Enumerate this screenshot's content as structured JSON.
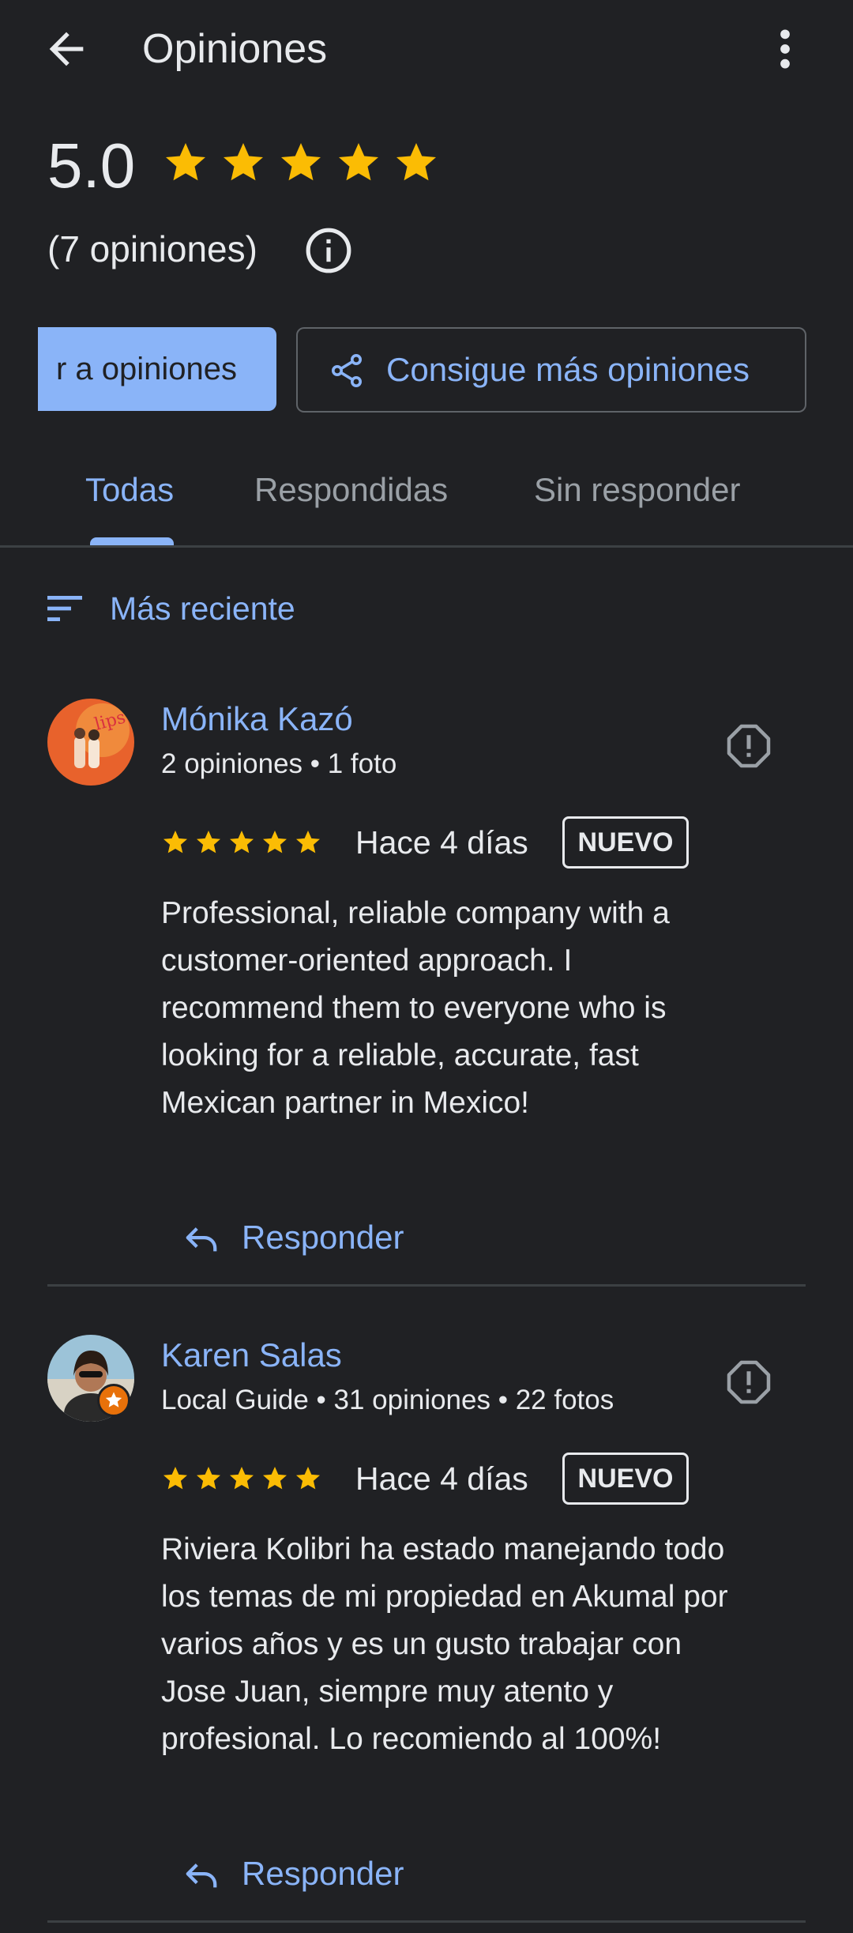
{
  "header": {
    "title": "Opiniones",
    "back_icon": "arrow-left-icon",
    "more_icon": "more-vert-icon"
  },
  "summary": {
    "rating": "5.0",
    "stars": 5,
    "count_text": "(7 opiniones)",
    "star_color": "#fbbc04"
  },
  "actions": {
    "primary_label": "Responder a opiniones",
    "primary_visible": "r a opiniones",
    "secondary_label": "Consigue más opiniones"
  },
  "tabs": [
    {
      "label": "Todas",
      "active": true
    },
    {
      "label": "Respondidas",
      "active": false
    },
    {
      "label": "Sin responder",
      "active": false
    }
  ],
  "sort": {
    "label": "Más reciente"
  },
  "reviews": [
    {
      "name": "Mónika Kazó",
      "meta": "2 opiniones • 1 foto",
      "stars": 5,
      "date": "Hace 4 días",
      "badge": "NUEVO",
      "lines": [
        "Professional, reliable company with a",
        "customer-oriented approach. I",
        "recommend them to everyone who is",
        "looking for a reliable, accurate, fast",
        "Mexican partner in Mexico!"
      ],
      "reply_label": "Responder"
    },
    {
      "name": "Karen Salas",
      "meta": "Local Guide • 31 opiniones • 22 fotos",
      "stars": 5,
      "date": "Hace 4 días",
      "badge": "NUEVO",
      "lines": [
        "Riviera Kolibri ha estado manejando todo",
        "los temas de mi propiedad en Akumal por",
        "varios años y es un gusto trabajar con",
        "Jose Juan, siempre muy atento y",
        "profesional. Lo recomiendo al 100%!"
      ],
      "reply_label": "Responder"
    }
  ],
  "colors": {
    "background": "#202124",
    "accent": "#8ab4f8",
    "text": "#e8eaed",
    "muted": "#9aa0a6",
    "local_guide": "#e8710a"
  }
}
